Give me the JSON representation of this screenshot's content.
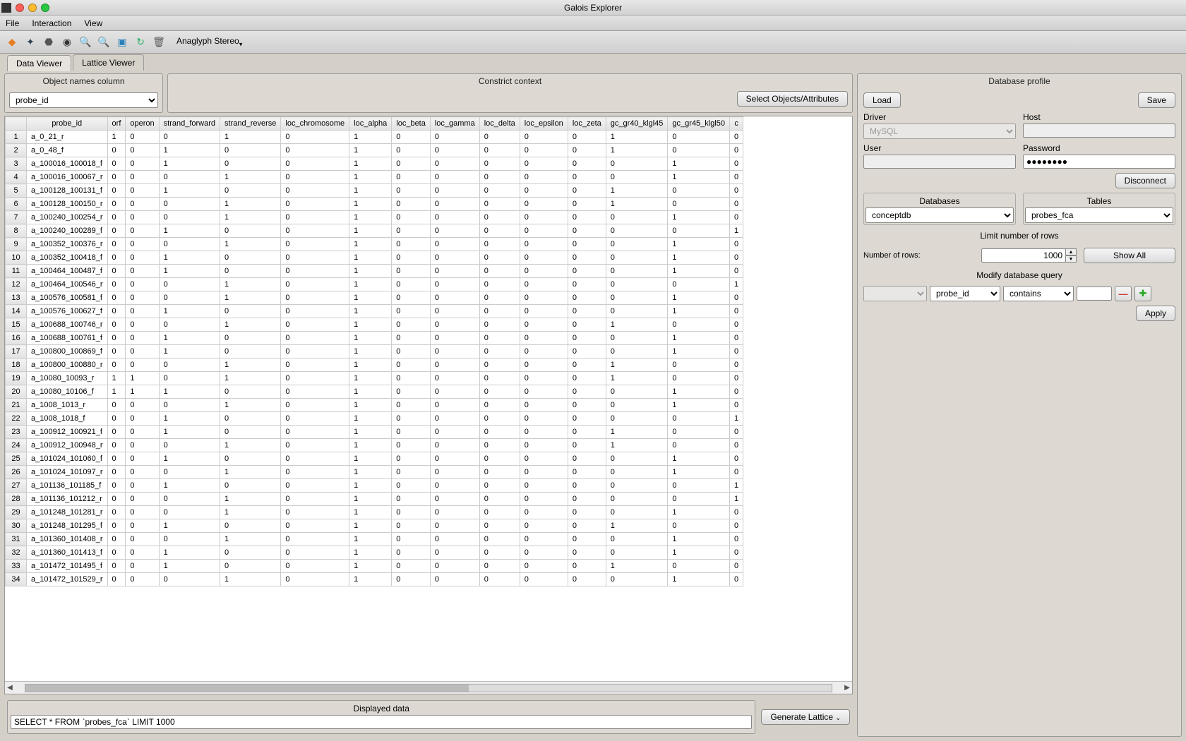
{
  "window": {
    "title": "Galois Explorer"
  },
  "menubar": {
    "file": "File",
    "interaction": "Interaction",
    "view": "View"
  },
  "toolbar": {
    "stereo": "Anaglyph Stereo"
  },
  "tabs": {
    "data_viewer": "Data Viewer",
    "lattice_viewer": "Lattice Viewer"
  },
  "objcol": {
    "title": "Object names column",
    "selected": "probe_id"
  },
  "constrict": {
    "title": "Constrict context",
    "select_btn": "Select Objects/Attributes"
  },
  "grid": {
    "columns": [
      "probe_id",
      "orf",
      "operon",
      "strand_forward",
      "strand_reverse",
      "loc_chromosome",
      "loc_alpha",
      "loc_beta",
      "loc_gamma",
      "loc_delta",
      "loc_epsilon",
      "loc_zeta",
      "gc_gr40_klgl45",
      "gc_gr45_klgl50",
      "c"
    ],
    "rows": [
      [
        "a_0_21_r",
        "1",
        "0",
        "0",
        "1",
        "0",
        "1",
        "0",
        "0",
        "0",
        "0",
        "0",
        "1",
        "0",
        "0"
      ],
      [
        "a_0_48_f",
        "0",
        "0",
        "1",
        "0",
        "0",
        "1",
        "0",
        "0",
        "0",
        "0",
        "0",
        "1",
        "0",
        "0"
      ],
      [
        "a_100016_100018_f",
        "0",
        "0",
        "1",
        "0",
        "0",
        "1",
        "0",
        "0",
        "0",
        "0",
        "0",
        "0",
        "1",
        "0"
      ],
      [
        "a_100016_100067_r",
        "0",
        "0",
        "0",
        "1",
        "0",
        "1",
        "0",
        "0",
        "0",
        "0",
        "0",
        "0",
        "1",
        "0"
      ],
      [
        "a_100128_100131_f",
        "0",
        "0",
        "1",
        "0",
        "0",
        "1",
        "0",
        "0",
        "0",
        "0",
        "0",
        "1",
        "0",
        "0"
      ],
      [
        "a_100128_100150_r",
        "0",
        "0",
        "0",
        "1",
        "0",
        "1",
        "0",
        "0",
        "0",
        "0",
        "0",
        "1",
        "0",
        "0"
      ],
      [
        "a_100240_100254_r",
        "0",
        "0",
        "0",
        "1",
        "0",
        "1",
        "0",
        "0",
        "0",
        "0",
        "0",
        "0",
        "1",
        "0"
      ],
      [
        "a_100240_100289_f",
        "0",
        "0",
        "1",
        "0",
        "0",
        "1",
        "0",
        "0",
        "0",
        "0",
        "0",
        "0",
        "0",
        "1"
      ],
      [
        "a_100352_100376_r",
        "0",
        "0",
        "0",
        "1",
        "0",
        "1",
        "0",
        "0",
        "0",
        "0",
        "0",
        "0",
        "1",
        "0"
      ],
      [
        "a_100352_100418_f",
        "0",
        "0",
        "1",
        "0",
        "0",
        "1",
        "0",
        "0",
        "0",
        "0",
        "0",
        "0",
        "1",
        "0"
      ],
      [
        "a_100464_100487_f",
        "0",
        "0",
        "1",
        "0",
        "0",
        "1",
        "0",
        "0",
        "0",
        "0",
        "0",
        "0",
        "1",
        "0"
      ],
      [
        "a_100464_100546_r",
        "0",
        "0",
        "0",
        "1",
        "0",
        "1",
        "0",
        "0",
        "0",
        "0",
        "0",
        "0",
        "0",
        "1"
      ],
      [
        "a_100576_100581_f",
        "0",
        "0",
        "0",
        "1",
        "0",
        "1",
        "0",
        "0",
        "0",
        "0",
        "0",
        "0",
        "1",
        "0"
      ],
      [
        "a_100576_100627_f",
        "0",
        "0",
        "1",
        "0",
        "0",
        "1",
        "0",
        "0",
        "0",
        "0",
        "0",
        "0",
        "1",
        "0"
      ],
      [
        "a_100688_100746_r",
        "0",
        "0",
        "0",
        "1",
        "0",
        "1",
        "0",
        "0",
        "0",
        "0",
        "0",
        "1",
        "0",
        "0"
      ],
      [
        "a_100688_100761_f",
        "0",
        "0",
        "1",
        "0",
        "0",
        "1",
        "0",
        "0",
        "0",
        "0",
        "0",
        "0",
        "1",
        "0"
      ],
      [
        "a_100800_100869_f",
        "0",
        "0",
        "1",
        "0",
        "0",
        "1",
        "0",
        "0",
        "0",
        "0",
        "0",
        "0",
        "1",
        "0"
      ],
      [
        "a_100800_100880_r",
        "0",
        "0",
        "0",
        "1",
        "0",
        "1",
        "0",
        "0",
        "0",
        "0",
        "0",
        "1",
        "0",
        "0"
      ],
      [
        "a_10080_10093_r",
        "1",
        "1",
        "0",
        "1",
        "0",
        "1",
        "0",
        "0",
        "0",
        "0",
        "0",
        "1",
        "0",
        "0"
      ],
      [
        "a_10080_10106_f",
        "1",
        "1",
        "1",
        "0",
        "0",
        "1",
        "0",
        "0",
        "0",
        "0",
        "0",
        "0",
        "1",
        "0"
      ],
      [
        "a_1008_1013_r",
        "0",
        "0",
        "0",
        "1",
        "0",
        "1",
        "0",
        "0",
        "0",
        "0",
        "0",
        "0",
        "1",
        "0"
      ],
      [
        "a_1008_1018_f",
        "0",
        "0",
        "1",
        "0",
        "0",
        "1",
        "0",
        "0",
        "0",
        "0",
        "0",
        "0",
        "0",
        "1"
      ],
      [
        "a_100912_100921_f",
        "0",
        "0",
        "1",
        "0",
        "0",
        "1",
        "0",
        "0",
        "0",
        "0",
        "0",
        "1",
        "0",
        "0"
      ],
      [
        "a_100912_100948_r",
        "0",
        "0",
        "0",
        "1",
        "0",
        "1",
        "0",
        "0",
        "0",
        "0",
        "0",
        "1",
        "0",
        "0"
      ],
      [
        "a_101024_101060_f",
        "0",
        "0",
        "1",
        "0",
        "0",
        "1",
        "0",
        "0",
        "0",
        "0",
        "0",
        "0",
        "1",
        "0"
      ],
      [
        "a_101024_101097_r",
        "0",
        "0",
        "0",
        "1",
        "0",
        "1",
        "0",
        "0",
        "0",
        "0",
        "0",
        "0",
        "1",
        "0"
      ],
      [
        "a_101136_101185_f",
        "0",
        "0",
        "1",
        "0",
        "0",
        "1",
        "0",
        "0",
        "0",
        "0",
        "0",
        "0",
        "0",
        "1"
      ],
      [
        "a_101136_101212_r",
        "0",
        "0",
        "0",
        "1",
        "0",
        "1",
        "0",
        "0",
        "0",
        "0",
        "0",
        "0",
        "0",
        "1"
      ],
      [
        "a_101248_101281_r",
        "0",
        "0",
        "0",
        "1",
        "0",
        "1",
        "0",
        "0",
        "0",
        "0",
        "0",
        "0",
        "1",
        "0"
      ],
      [
        "a_101248_101295_f",
        "0",
        "0",
        "1",
        "0",
        "0",
        "1",
        "0",
        "0",
        "0",
        "0",
        "0",
        "1",
        "0",
        "0"
      ],
      [
        "a_101360_101408_r",
        "0",
        "0",
        "0",
        "1",
        "0",
        "1",
        "0",
        "0",
        "0",
        "0",
        "0",
        "0",
        "1",
        "0"
      ],
      [
        "a_101360_101413_f",
        "0",
        "0",
        "1",
        "0",
        "0",
        "1",
        "0",
        "0",
        "0",
        "0",
        "0",
        "0",
        "1",
        "0"
      ],
      [
        "a_101472_101495_f",
        "0",
        "0",
        "1",
        "0",
        "0",
        "1",
        "0",
        "0",
        "0",
        "0",
        "0",
        "1",
        "0",
        "0"
      ],
      [
        "a_101472_101529_r",
        "0",
        "0",
        "0",
        "1",
        "0",
        "1",
        "0",
        "0",
        "0",
        "0",
        "0",
        "0",
        "1",
        "0"
      ]
    ]
  },
  "displayed": {
    "title": "Displayed data",
    "sql": "SELECT * FROM `probes_fca` LIMIT 1000",
    "gen_btn": "Generate Lattice"
  },
  "dbprofile": {
    "title": "Database profile",
    "load": "Load",
    "save": "Save",
    "driver_lbl": "Driver",
    "driver": "MySQL",
    "host_lbl": "Host",
    "host": "",
    "user_lbl": "User",
    "user": "",
    "password_lbl": "Password",
    "password": "●●●●●●●●",
    "disconnect": "Disconnect",
    "databases_lbl": "Databases",
    "database": "conceptdb",
    "tables_lbl": "Tables",
    "table": "probes_fca",
    "limit_title": "Limit number of rows",
    "numrows_lbl": "Number of rows:",
    "numrows": "1000",
    "showall": "Show All",
    "modify_title": "Modify database query",
    "q_col": "probe_id",
    "q_op": "contains",
    "q_val": "",
    "apply": "Apply"
  }
}
